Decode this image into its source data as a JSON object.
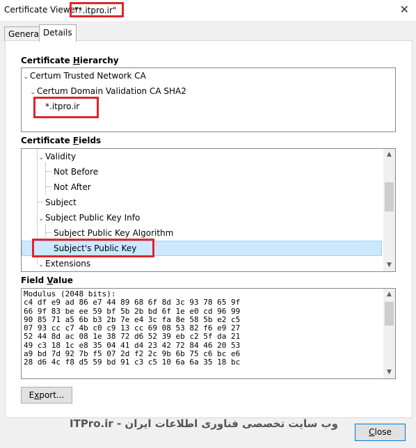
{
  "window": {
    "title": "Certificate Viewer:",
    "title_quoted": "\"*.itpro.ir\"",
    "close_icon": "close-icon"
  },
  "tabs": [
    {
      "label": "General"
    },
    {
      "label": "Details"
    }
  ],
  "hierarchy": {
    "label_pre": "Certificate ",
    "label_u": "H",
    "label_post": "ierarchy",
    "items": [
      {
        "label": "Certum Trusted Network CA"
      },
      {
        "label": "Certum Domain Validation CA SHA2"
      },
      {
        "label": "*.itpro.ir"
      }
    ]
  },
  "fields": {
    "label_pre": "Certificate ",
    "label_u": "F",
    "label_post": "ields",
    "items": [
      {
        "label": "Validity"
      },
      {
        "label": "Not Before"
      },
      {
        "label": "Not After"
      },
      {
        "label": "Subject"
      },
      {
        "label": "Subject Public Key Info"
      },
      {
        "label": "Subject Public Key Algorithm"
      },
      {
        "label": "Subject's Public Key"
      },
      {
        "label": "Extensions"
      }
    ]
  },
  "field_value": {
    "label_pre": "Field ",
    "label_u": "V",
    "label_post": "alue",
    "lines": [
      "Modulus (2048 bits):",
      "c4 df e9 ad 86 e7 44 89 68 6f 8d 3c 93 78 65 9f",
      "66 9f 83 be ee 59 bf 5b 2b bd 6f 1e e0 cd 96 99",
      "90 85 71 a5 6b b3 2b 7e e4 3c fa 8e 58 5b e2 c5",
      "07 93 cc c7 4b c0 c9 13 cc 69 08 53 82 f6 e9 27",
      "52 44 8d ac 08 1e 38 72 d6 52 39 eb c2 5f da 21",
      "49 c3 18 1c e8 35 04 41 d4 23 42 72 84 46 20 53",
      "a9 bd 7d 92 7b f5 07 2d f2 2c 9b 6b 75 c6 bc e6",
      "28 d6 4c f8 d5 59 bd 91 c3 c5 10 6a 6a 35 18 bc"
    ]
  },
  "buttons": {
    "export_pre": "E",
    "export_u": "x",
    "export_post": "port...",
    "close_u": "C",
    "close_post": "lose"
  },
  "watermark": "ITPro.ir - وب سایت تخصصی فناوری اطلاعات ایران",
  "colors": {
    "highlight": "#e0242c",
    "selection": "#cce8ff"
  }
}
